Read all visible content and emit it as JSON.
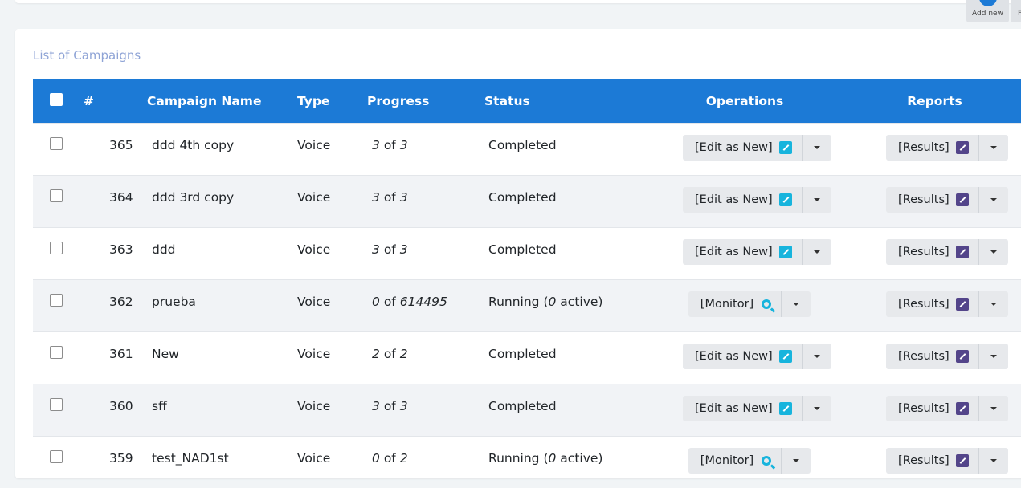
{
  "header": {
    "add_new_label": "Add new",
    "second_button_fragment": "F"
  },
  "card": {
    "title": "List of Campaigns"
  },
  "table": {
    "columns": [
      "#",
      "Campaign Name",
      "Type",
      "Progress",
      "Status",
      "Operations",
      "Reports"
    ],
    "rows": [
      {
        "id": "365",
        "name": "ddd 4th copy",
        "type": "Voice",
        "done": "3",
        "of": "of",
        "total": "3",
        "status": "Completed",
        "op": "[Edit as New]",
        "op_icon": "edit-icon",
        "report": "[Results]"
      },
      {
        "id": "364",
        "name": "ddd 3rd copy",
        "type": "Voice",
        "done": "3",
        "of": "of",
        "total": "3",
        "status": "Completed",
        "op": "[Edit as New]",
        "op_icon": "edit-icon",
        "report": "[Results]"
      },
      {
        "id": "363",
        "name": "ddd",
        "type": "Voice",
        "done": "3",
        "of": "of",
        "total": "3",
        "status": "Completed",
        "op": "[Edit as New]",
        "op_icon": "edit-icon",
        "report": "[Results]"
      },
      {
        "id": "362",
        "name": "prueba",
        "type": "Voice",
        "done": "0",
        "of": "of",
        "total": "614495",
        "status_prefix": "Running (",
        "status_active": "0",
        "status_suffix": " active)",
        "op": "[Monitor]",
        "op_icon": "search-icon",
        "report": "[Results]"
      },
      {
        "id": "361",
        "name": "New",
        "type": "Voice",
        "done": "2",
        "of": "of",
        "total": "2",
        "status": "Completed",
        "op": "[Edit as New]",
        "op_icon": "edit-icon",
        "report": "[Results]"
      },
      {
        "id": "360",
        "name": "sff",
        "type": "Voice",
        "done": "3",
        "of": "of",
        "total": "3",
        "status": "Completed",
        "op": "[Edit as New]",
        "op_icon": "edit-icon",
        "report": "[Results]"
      },
      {
        "id": "359",
        "name": "test_NAD1st",
        "type": "Voice",
        "done": "0",
        "of": "of",
        "total": "2",
        "status_prefix": "Running (",
        "status_active": "0",
        "status_suffix": " active)",
        "op": "[Monitor]",
        "op_icon": "search-icon",
        "report": "[Results]"
      }
    ]
  },
  "colors": {
    "header_bg": "#1c7ad6",
    "edit_icon": "#17b4dd",
    "results_icon": "#53458a",
    "title": "#8fa4d6"
  }
}
